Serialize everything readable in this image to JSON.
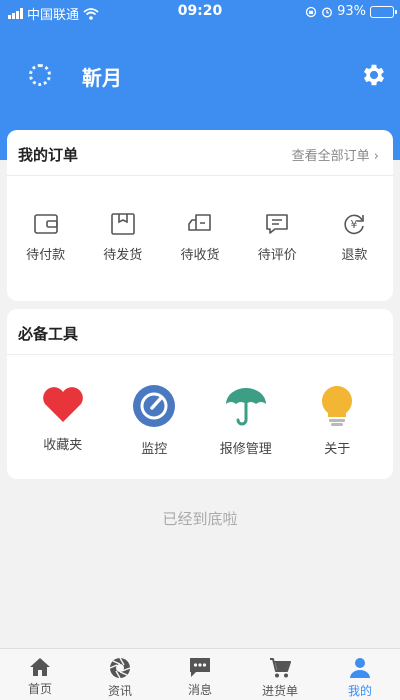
{
  "status_bar": {
    "carrier": "中国联通",
    "time": "09:20",
    "battery": "93%"
  },
  "profile": {
    "name": "靳月"
  },
  "orders": {
    "title": "我的订单",
    "view_all": "查看全部订单 ›",
    "items": [
      {
        "label": "待付款",
        "icon": "wallet-icon"
      },
      {
        "label": "待发货",
        "icon": "package-icon"
      },
      {
        "label": "待收货",
        "icon": "truck-icon"
      },
      {
        "label": "待评价",
        "icon": "comment-icon"
      },
      {
        "label": "退款",
        "icon": "refund-icon"
      }
    ]
  },
  "tools": {
    "title": "必备工具",
    "items": [
      {
        "label": "收藏夹",
        "icon": "heart-icon",
        "color": "#e8343b"
      },
      {
        "label": "监控",
        "icon": "dial-icon",
        "color": "#4a79c2"
      },
      {
        "label": "报修管理",
        "icon": "umbrella-icon",
        "color": "#3d9e86"
      },
      {
        "label": "关于",
        "icon": "lightbulb-icon",
        "color": "#f2b534"
      }
    ]
  },
  "footer_note": "已经到底啦",
  "tabs": [
    {
      "label": "首页",
      "icon": "home-icon"
    },
    {
      "label": "资讯",
      "icon": "aperture-icon"
    },
    {
      "label": "消息",
      "icon": "chat-icon"
    },
    {
      "label": "进货单",
      "icon": "cart-icon"
    },
    {
      "label": "我的",
      "icon": "user-icon",
      "active": true
    }
  ],
  "colors": {
    "primary": "#3d8ef0",
    "background": "#f2f2f2"
  }
}
